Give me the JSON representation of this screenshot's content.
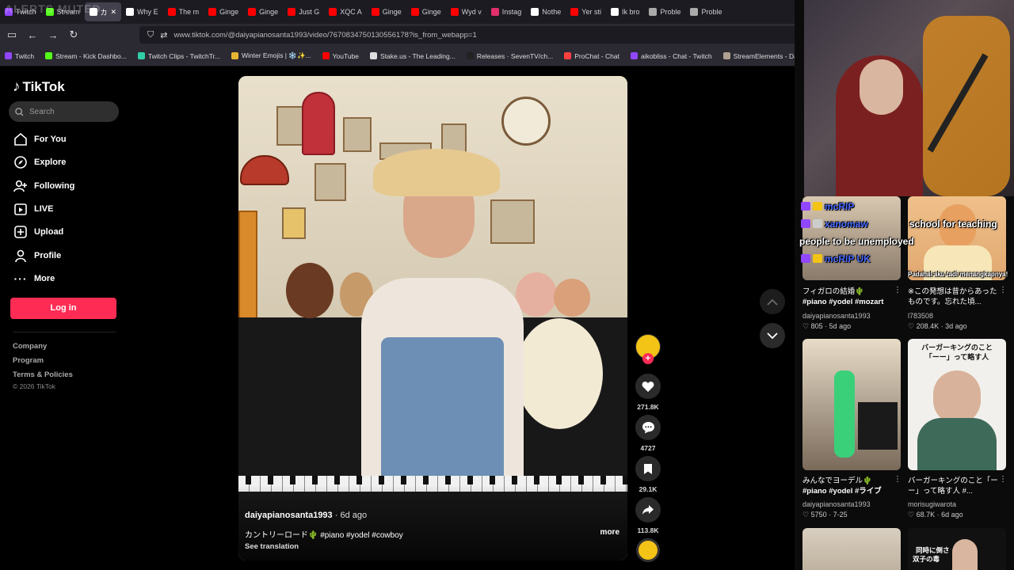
{
  "browser": {
    "watermark": "ALERTS MUTED",
    "tabs": [
      {
        "label": "Twitch",
        "color": "#9146ff",
        "active": false
      },
      {
        "label": "Stream",
        "color": "#53fc18",
        "active": false
      },
      {
        "label": "カ",
        "color": "#ffffff",
        "active": true
      },
      {
        "label": "Why E",
        "color": "#ffffff",
        "active": false
      },
      {
        "label": "The m",
        "color": "#ff0000",
        "active": false
      },
      {
        "label": "Ginge",
        "color": "#ff0000",
        "active": false
      },
      {
        "label": "Ginge",
        "color": "#ff0000",
        "active": false
      },
      {
        "label": "Just G",
        "color": "#ff0000",
        "active": false
      },
      {
        "label": "XQC A",
        "color": "#ff0000",
        "active": false
      },
      {
        "label": "Ginge",
        "color": "#ff0000",
        "active": false
      },
      {
        "label": "Ginge",
        "color": "#ff0000",
        "active": false
      },
      {
        "label": "Wyd v",
        "color": "#ff0000",
        "active": false
      },
      {
        "label": "Instag",
        "color": "#e1306c",
        "active": false
      },
      {
        "label": "Nothe",
        "color": "#ffffff",
        "active": false
      },
      {
        "label": "Yer sti",
        "color": "#ff0000",
        "active": false
      },
      {
        "label": "Ik bro",
        "color": "#ffffff",
        "active": false
      },
      {
        "label": "Proble",
        "color": "#aaaaaa",
        "active": false
      },
      {
        "label": "Proble",
        "color": "#aaaaaa",
        "active": false
      }
    ],
    "url": "www.tiktok.com/@daiyapianosanta1993/video/7670834750130556178?is_from_webapp=1",
    "bookmarks": [
      {
        "label": "Twitch",
        "color": "#9146ff"
      },
      {
        "label": "Stream - Kick Dashbo...",
        "color": "#53fc18"
      },
      {
        "label": "Twitch Clips - TwitchTr...",
        "color": "#2fd0a8"
      },
      {
        "label": "Winter Emojis | ❄️✨...",
        "color": "#e8b530"
      },
      {
        "label": "YouTube",
        "color": "#ff0000"
      },
      {
        "label": "Stake.us - The Leading...",
        "color": "#dddddd"
      },
      {
        "label": "Releases · SevenTV/ch...",
        "color": "#222222"
      },
      {
        "label": "ProChat - Chat",
        "color": "#ff4040"
      },
      {
        "label": "aikobliss - Chat - Twitch",
        "color": "#9146ff"
      },
      {
        "label": "StreamElements - Das...",
        "color": "#b0a090"
      }
    ]
  },
  "sidebar": {
    "logo": "TikTok",
    "search_placeholder": "Search",
    "nav": [
      {
        "label": "For You",
        "icon": "home-icon"
      },
      {
        "label": "Explore",
        "icon": "compass-icon"
      },
      {
        "label": "Following",
        "icon": "following-icon"
      },
      {
        "label": "LIVE",
        "icon": "live-icon"
      },
      {
        "label": "Upload",
        "icon": "upload-icon"
      },
      {
        "label": "Profile",
        "icon": "profile-icon"
      },
      {
        "label": "More",
        "icon": "more-icon"
      }
    ],
    "login": "Log in",
    "footer": [
      "Company",
      "Program",
      "Terms & Policies"
    ],
    "copyright": "© 2026 TikTok"
  },
  "video": {
    "author": "daiyapianosanta1993",
    "ago": "· 6d ago",
    "caption": "カントリーロード🌵 #piano #yodel #cowboy",
    "more": "more",
    "translation": "See translation"
  },
  "actions": {
    "likes": "271.8K",
    "comments": "4727",
    "saves": "29.1K",
    "shares": "113.8K"
  },
  "chat_overlay": [
    {
      "text": "mcRIP",
      "badge": "#9146ff"
    },
    {
      "text": "xanomaw",
      "badge": "#888888"
    },
    {
      "text": "people to be unemployed",
      "badge": ""
    },
    {
      "text": "mcRIP UK",
      "badge": "#9146ff"
    },
    {
      "text": "school for teaching",
      "badge": ""
    },
    {
      "text": "Padahal aku tadi menangkapnya!",
      "badge": ""
    }
  ],
  "related": [
    {
      "title": "フィガロの結婚🌵",
      "tags": "#piano #yodel #mozart",
      "author": "daiyapianosanta1993",
      "likes": "805",
      "ago": "5d ago"
    },
    {
      "title": "※この発想は昔からあったものです。忘れた頃...",
      "tags": "",
      "author": "l783508",
      "likes": "208.4K",
      "ago": "3d ago"
    },
    {
      "title": "みんなでヨーデル🌵",
      "tags": "#piano #yodel #ライブ",
      "author": "daiyapianosanta1993",
      "likes": "5750",
      "ago": "7-25"
    },
    {
      "title": "バーガーキングのこと「ーー」って略す人 #...",
      "tags": "",
      "author": "morisugiwarota",
      "likes": "68.7K",
      "ago": "6d ago"
    }
  ],
  "thumb_texts": {
    "burger_top": "バーガーキングのこと",
    "burger_bottom": "「ーー」って略す人",
    "last_line1": "同時に倒さ",
    "last_line2": "双子の毒"
  }
}
